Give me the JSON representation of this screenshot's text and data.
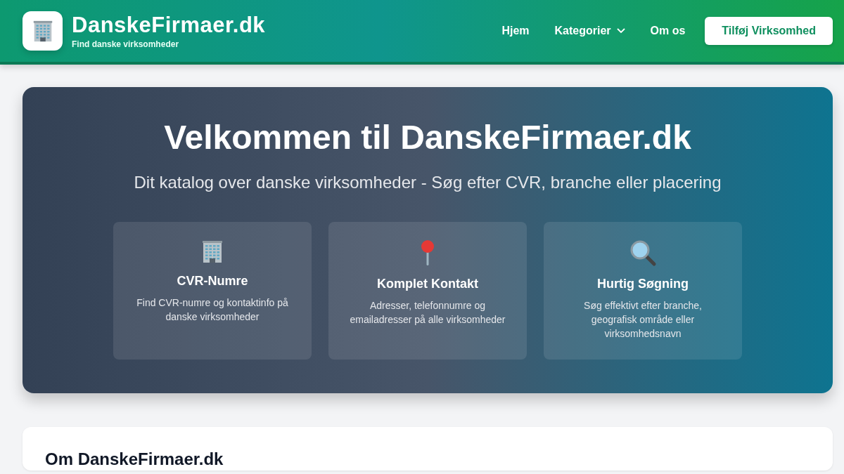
{
  "header": {
    "logo_title": "DanskeFirmaer.dk",
    "logo_subtitle": "Find danske virksomheder",
    "nav": [
      {
        "label": "Hjem",
        "dropdown": false
      },
      {
        "label": "Kategorier",
        "dropdown": true
      },
      {
        "label": "Om os",
        "dropdown": false
      }
    ],
    "cta_button": "Tilføj Virksomhed"
  },
  "hero": {
    "title": "Velkommen til DanskeFirmaer.dk",
    "subtitle": "Dit katalog over danske virksomheder - Søg efter CVR, branche eller placering",
    "features": [
      {
        "kind": "building",
        "title": "CVR-Numre",
        "text": "Find CVR-numre og kontaktinfo på danske virksomheder"
      },
      {
        "kind": "pin",
        "title": "Komplet Kontakt",
        "text": "Adresser, telefonnumre og emailadresser på alle virksomheder"
      },
      {
        "kind": "search",
        "title": "Hurtig Søgning",
        "text": "Søg effektivt efter branche, geografisk område eller virksomhedsnavn"
      }
    ]
  },
  "about": {
    "title": "Om DanskeFirmaer.dk"
  }
}
